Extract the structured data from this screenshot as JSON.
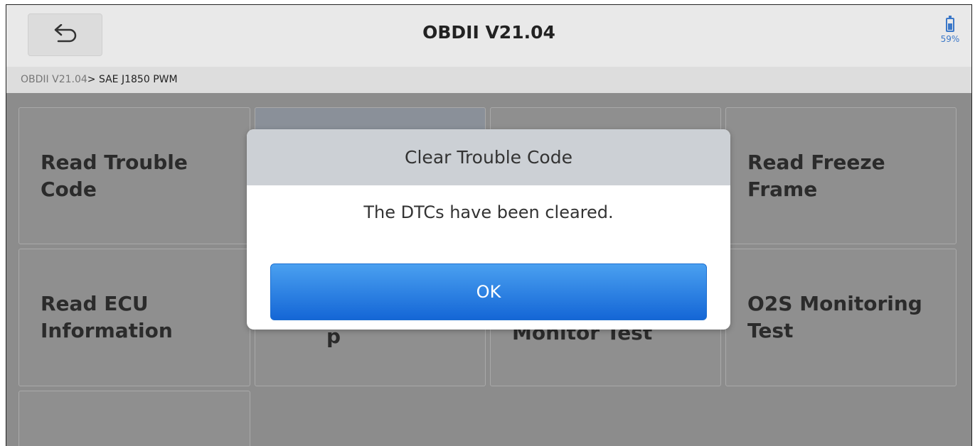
{
  "header": {
    "title": "OBDII V21.04",
    "back_icon": "back-arrow-icon",
    "battery_percent": "59%",
    "battery_level": 0.59
  },
  "breadcrumb": {
    "root": "OBDII V21.04",
    "current": "> SAE J1850 PWM"
  },
  "tiles": [
    {
      "label": "Read Trouble Code"
    },
    {
      "label": ""
    },
    {
      "label": ""
    },
    {
      "label": "Read Freeze Frame"
    },
    {
      "label": "Read ECU Information"
    },
    {
      "label": "p"
    },
    {
      "label": "Monitor Test"
    },
    {
      "label": "O2S Monitoring Test"
    },
    {
      "label": ""
    }
  ],
  "dialog": {
    "title": "Clear Trouble Code",
    "message": "The DTCs have been cleared.",
    "ok_label": "OK"
  }
}
